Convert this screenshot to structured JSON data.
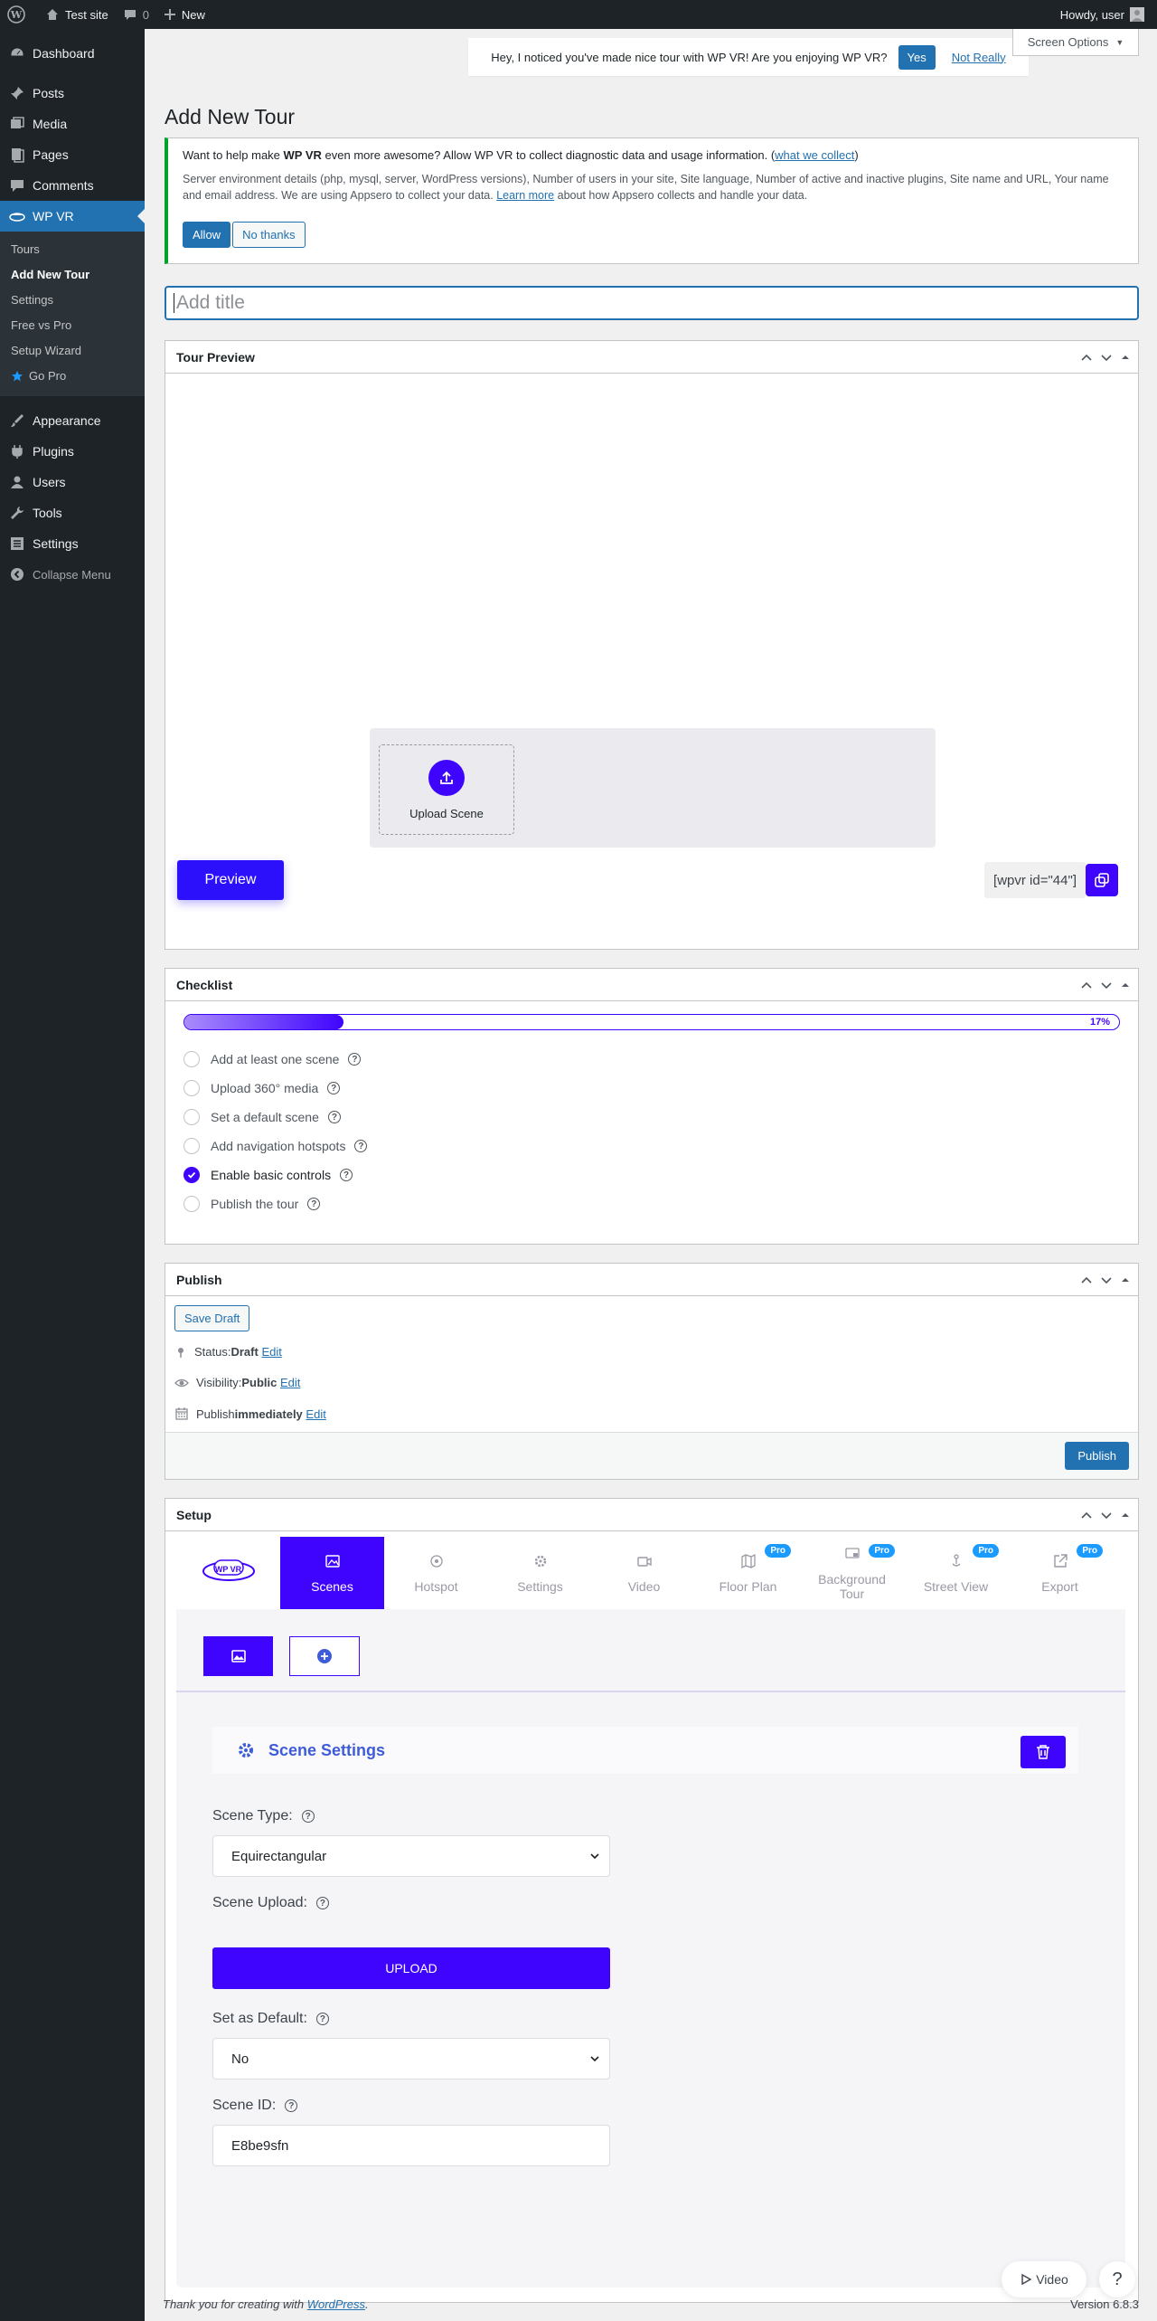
{
  "adminbar": {
    "site_name": "Test site",
    "comments_count": "0",
    "new_label": "New",
    "howdy": "Howdy, user"
  },
  "sidebar": {
    "items": [
      {
        "label": "Dashboard",
        "icon": "dashboard-icon"
      },
      {
        "label": "Posts",
        "icon": "pin-icon"
      },
      {
        "label": "Media",
        "icon": "media-icon"
      },
      {
        "label": "Pages",
        "icon": "pages-icon"
      },
      {
        "label": "Comments",
        "icon": "comment-icon"
      },
      {
        "label": "WP VR",
        "icon": "wpvr-icon"
      }
    ],
    "submenu": [
      {
        "label": "Tours"
      },
      {
        "label": "Add New Tour"
      },
      {
        "label": "Settings"
      },
      {
        "label": "Free vs Pro"
      },
      {
        "label": "Setup Wizard"
      },
      {
        "label": "Go Pro"
      }
    ],
    "items_after": [
      {
        "label": "Appearance",
        "icon": "appearance-icon"
      },
      {
        "label": "Plugins",
        "icon": "plugins-icon"
      },
      {
        "label": "Users",
        "icon": "users-icon"
      },
      {
        "label": "Tools",
        "icon": "tools-icon"
      },
      {
        "label": "Settings",
        "icon": "settings-icon"
      },
      {
        "label": "Collapse Menu",
        "icon": "collapse-icon"
      }
    ]
  },
  "top_notice": {
    "text": "Hey, I noticed you've made nice tour with WP VR! Are you enjoying WP VR?",
    "yes": "Yes",
    "not_really": "Not Really"
  },
  "screen_options": "Screen Options",
  "page_title": "Add New Tour",
  "allow_notice": {
    "line1_pre": "Want to help make ",
    "line1_bold": "WP VR",
    "line1_post": " even more awesome? Allow WP VR to collect diagnostic data and usage information. (",
    "what_we_collect": "what we collect",
    "line1_end": ")",
    "details": "Server environment details (php, mysql, server, WordPress versions), Number of users in your site, Site language, Number of active and inactive plugins, Site name and URL, Your name and email address. We are using Appsero to collect your data.",
    "learn_more": "Learn more",
    "details_post": " about how Appsero collects and handle your data.",
    "allow": "Allow",
    "no_thanks": "No thanks"
  },
  "title_placeholder": "Add title",
  "tour_preview": {
    "heading": "Tour Preview",
    "upload_scene": "Upload Scene",
    "preview_btn": "Preview",
    "shortcode": "[wpvr id=\"44\"]"
  },
  "checklist": {
    "heading": "Checklist",
    "progress_label": "17%",
    "progress": 0.17,
    "items": [
      {
        "label": "Add at least one scene",
        "done": false
      },
      {
        "label": "Upload 360° media",
        "done": false
      },
      {
        "label": "Set a default scene",
        "done": false
      },
      {
        "label": "Add navigation hotspots",
        "done": false
      },
      {
        "label": "Enable basic controls",
        "done": true
      },
      {
        "label": "Publish the tour",
        "done": false
      }
    ]
  },
  "publish": {
    "heading": "Publish",
    "save_draft": "Save Draft",
    "status_label": "Status: ",
    "status_value": "Draft",
    "visibility_label": "Visibility: ",
    "visibility_value": "Public",
    "publish_label": "Publish ",
    "publish_value": "immediately",
    "edit": "Edit",
    "publish_btn": "Publish"
  },
  "setup": {
    "heading": "Setup",
    "logo_text": "WP VR",
    "tabs": [
      {
        "label": "Scenes",
        "active": true,
        "pro": false
      },
      {
        "label": "Hotspot",
        "active": false,
        "pro": false
      },
      {
        "label": "Settings",
        "active": false,
        "pro": false
      },
      {
        "label": "Video",
        "active": false,
        "pro": false
      },
      {
        "label": "Floor Plan",
        "active": false,
        "pro": true
      },
      {
        "label": "Background Tour",
        "active": false,
        "pro": true
      },
      {
        "label": "Street View",
        "active": false,
        "pro": true
      },
      {
        "label": "Export",
        "active": false,
        "pro": true
      }
    ],
    "pro_label": "Pro",
    "scene_settings": "Scene Settings",
    "scene_type_label": "Scene Type:",
    "scene_type_value": "Equirectangular",
    "scene_upload_label": "Scene Upload:",
    "upload_btn": "UPLOAD",
    "default_label": "Set as Default:",
    "default_value": "No",
    "scene_id_label": "Scene ID:",
    "scene_id_value": "E8be9sfn"
  },
  "footer": {
    "thanks_pre": "Thank you for creating with ",
    "wordpress": "WordPress",
    "thanks_post": ".",
    "version": "Version 6.8.3",
    "video_btn": "Video",
    "help": "?"
  },
  "colors": {
    "wp_blue": "#2271b1",
    "wpvr_purple": "#3f04fe",
    "admin_dark": "#1d2327",
    "pro_badge": "#1b9bff"
  }
}
